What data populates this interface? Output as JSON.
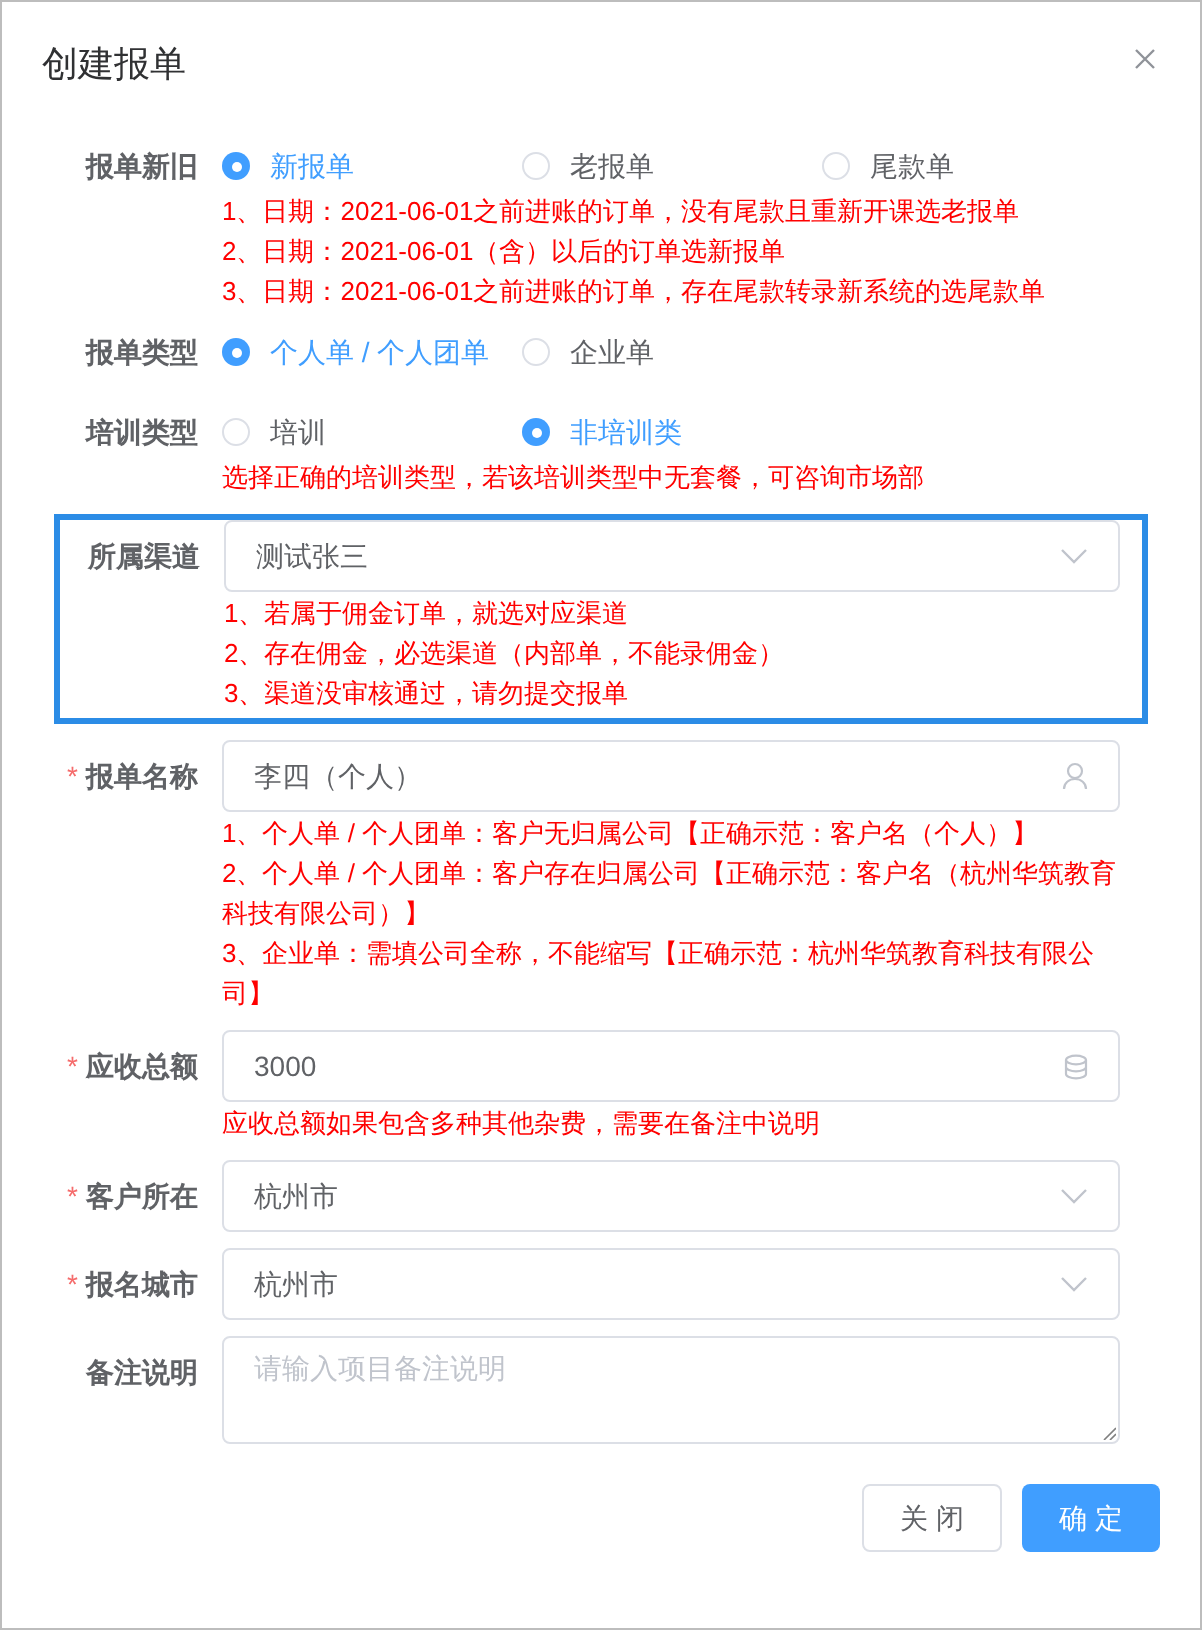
{
  "dialog": {
    "title": "创建报单"
  },
  "fields": [
    {
      "kind": "radio",
      "label": "报单新旧",
      "options": [
        {
          "label": "新报单",
          "selected": true
        },
        {
          "label": "老报单",
          "selected": false
        },
        {
          "label": "尾款单",
          "selected": false
        }
      ],
      "notes": [
        "1、日期：2021-06-01之前进账的订单，没有尾款且重新开课选老报单",
        "2、日期：2021-06-01（含）以后的订单选新报单",
        "3、日期：2021-06-01之前进账的订单，存在尾款转录新系统的选尾款单"
      ]
    },
    {
      "kind": "radio",
      "label": "报单类型",
      "options": [
        {
          "label": "个人单 / 个人团单",
          "selected": true
        },
        {
          "label": "企业单",
          "selected": false
        }
      ]
    },
    {
      "kind": "radio",
      "label": "培训类型",
      "options": [
        {
          "label": "培训",
          "selected": false
        },
        {
          "label": "非培训类",
          "selected": true
        }
      ],
      "notes": [
        "选择正确的培训类型，若该培训类型中无套餐，可咨询市场部"
      ]
    },
    {
      "kind": "select",
      "label": "所属渠道",
      "value": "测试张三",
      "highlighted": true,
      "notes": [
        "1、若属于佣金订单，就选对应渠道",
        "2、存在佣金，必选渠道（内部单，不能录佣金）",
        "3、渠道没审核通过，请勿提交报单"
      ]
    },
    {
      "kind": "person",
      "label": "报单名称",
      "required_mark": "*",
      "value": "李四（个人）",
      "notes": [
        "1、个人单 / 个人团单：客户无归属公司【正确示范：客户名（个人）】",
        "2、个人单 / 个人团单：客户存在归属公司【正确示范：客户名（杭州华筑教育科技有限公司）】",
        "3、企业单：需填公司全称，不能缩写【正确示范：杭州华筑教育科技有限公司】"
      ]
    },
    {
      "kind": "amount",
      "label": "应收总额",
      "required_mark": "*",
      "value": "3000",
      "notes": [
        "应收总额如果包含多种其他杂费，需要在备注中说明"
      ]
    },
    {
      "kind": "select",
      "label": "客户所在",
      "required_mark": "*",
      "value": "杭州市"
    },
    {
      "kind": "select",
      "label": "报名城市",
      "required_mark": "*",
      "value": "杭州市"
    },
    {
      "kind": "textarea",
      "label": "备注说明",
      "placeholder": "请输入项目备注说明"
    }
  ],
  "buttons": [
    {
      "label": "关 闭",
      "kind": "default"
    },
    {
      "label": "确 定",
      "kind": "primary"
    }
  ]
}
